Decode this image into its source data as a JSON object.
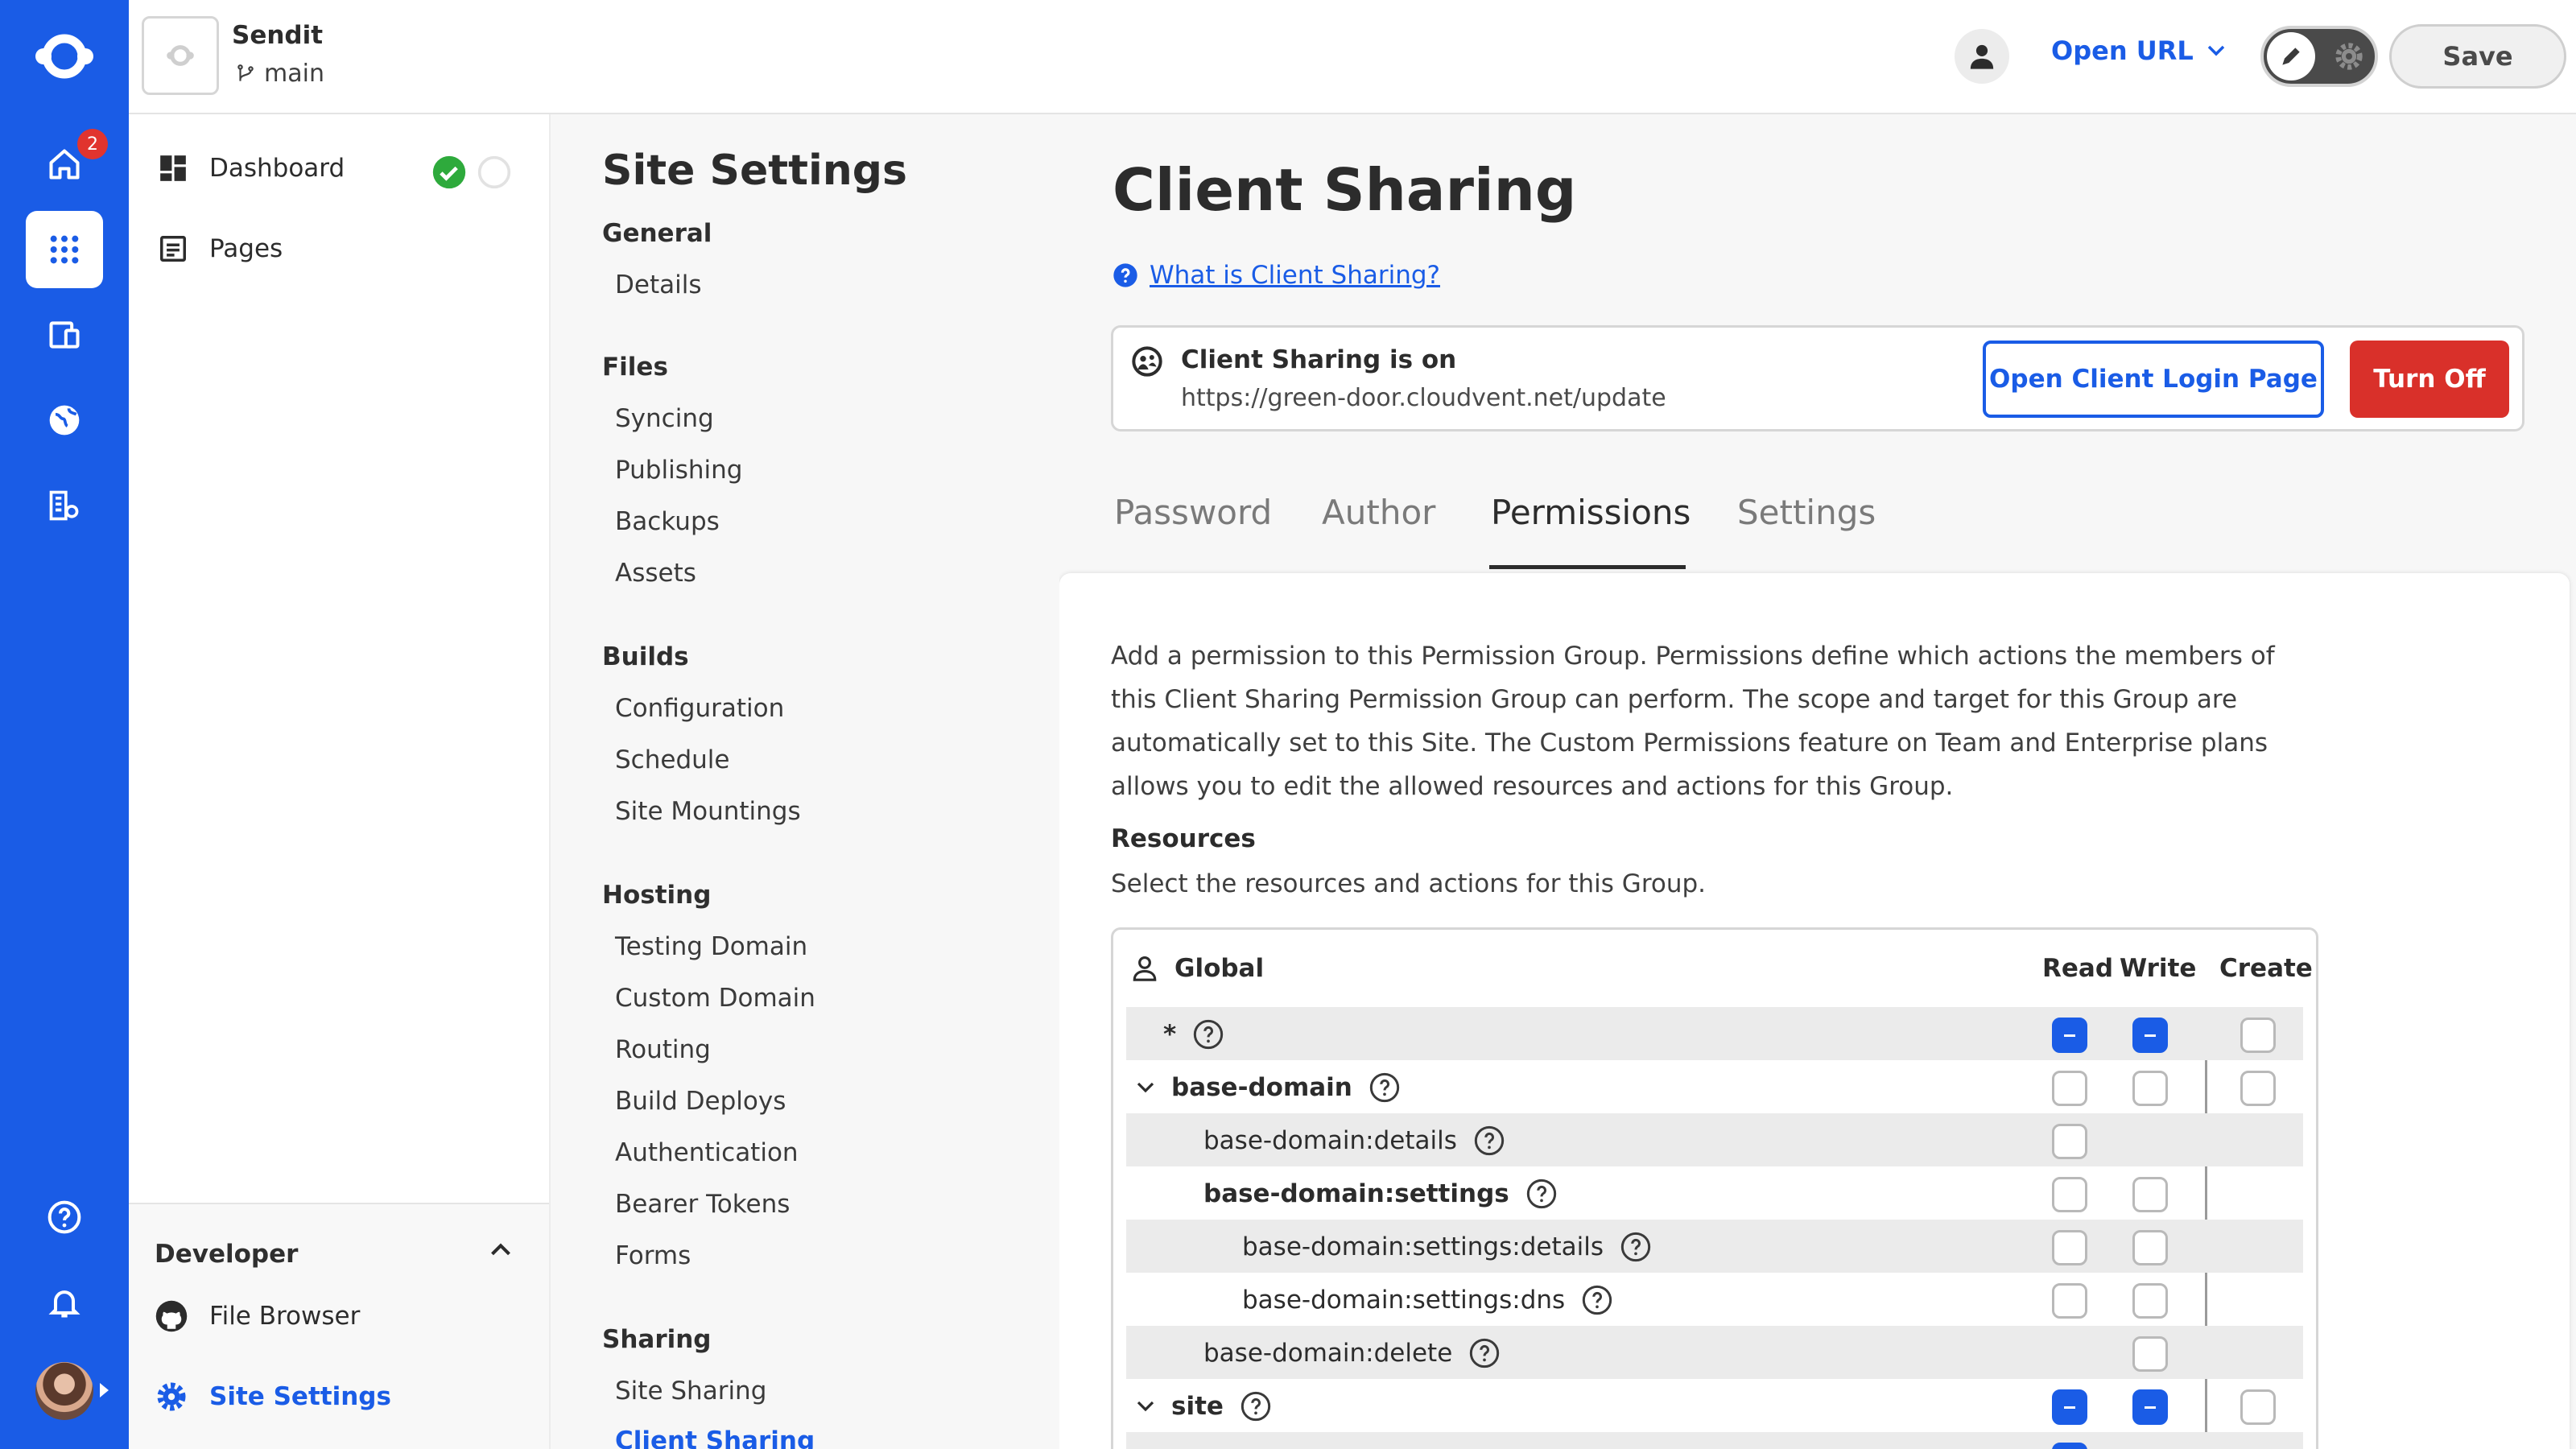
{
  "rail": {
    "badge_count": "2"
  },
  "topbar": {
    "project_name": "Sendit",
    "branch": "main",
    "open_url": "Open URL",
    "save": "Save"
  },
  "nav": {
    "dashboard": "Dashboard",
    "pages": "Pages",
    "developer": "Developer",
    "file_browser": "File Browser",
    "site_settings": "Site Settings"
  },
  "settings": {
    "title": "Site Settings",
    "sections": {
      "general": "General",
      "files": "Files",
      "builds": "Builds",
      "hosting": "Hosting",
      "sharing": "Sharing"
    },
    "links": {
      "details": "Details",
      "syncing": "Syncing",
      "publishing": "Publishing",
      "backups": "Backups",
      "assets": "Assets",
      "configuration": "Configuration",
      "schedule": "Schedule",
      "site_mountings": "Site Mountings",
      "testing_domain": "Testing Domain",
      "custom_domain": "Custom Domain",
      "routing": "Routing",
      "build_deploys": "Build Deploys",
      "authentication": "Authentication",
      "bearer_tokens": "Bearer Tokens",
      "forms": "Forms",
      "site_sharing": "Site Sharing",
      "client_sharing": "Client Sharing"
    }
  },
  "main": {
    "title": "Client Sharing",
    "what_is": "What is Client Sharing?",
    "status_title": "Client Sharing is on",
    "status_url": "https://green-door.cloudvent.net/update",
    "open_login": "Open Client Login Page",
    "turn_off": "Turn Off",
    "tabs": [
      "Password",
      "Author",
      "Permissions",
      "Settings"
    ],
    "description": "Add a permission to this Permission Group. Permissions define which actions the members of this Client Sharing Permission Group can perform. The scope and target for this Group are automatically set to this Site. The Custom Permissions feature on Team and Enterprise plans allows you to edit the allowed resources and actions for this Group.",
    "resources_heading": "Resources",
    "resources_sub": "Select the resources and actions for this Group."
  },
  "table": {
    "group": "Global",
    "columns": [
      "Read",
      "Write",
      "Create"
    ],
    "rows": [
      {
        "label": "*",
        "read": "indeterminate",
        "write": "indeterminate",
        "create": "unchecked"
      },
      {
        "label": "base-domain",
        "read": "unchecked",
        "write": "unchecked",
        "create": "unchecked"
      },
      {
        "label": "base-domain:details",
        "read": "unchecked"
      },
      {
        "label": "base-domain:settings",
        "read": "unchecked",
        "write": "unchecked"
      },
      {
        "label": "base-domain:settings:details",
        "read": "unchecked",
        "write": "unchecked"
      },
      {
        "label": "base-domain:settings:dns",
        "read": "unchecked",
        "write": "unchecked"
      },
      {
        "label": "base-domain:delete",
        "write": "unchecked"
      },
      {
        "label": "site",
        "read": "indeterminate",
        "write": "indeterminate",
        "create": "unchecked"
      }
    ]
  },
  "colors": {
    "accent": "#1a5ce6",
    "danger": "#d9302a",
    "success": "#2eaa3c"
  }
}
